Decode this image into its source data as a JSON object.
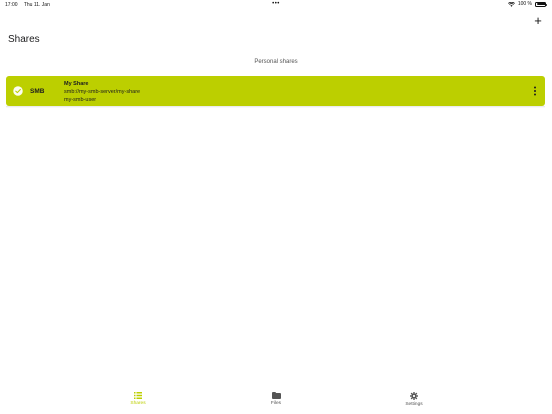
{
  "status_bar": {
    "time": "17:00",
    "date": "Thu 11. Jan",
    "battery": "100 %",
    "battery_level": 1.0
  },
  "header": {
    "title": "Shares",
    "add_icon": "plus-icon"
  },
  "section": {
    "title": "Personal shares"
  },
  "shares": [
    {
      "type": "SMB",
      "name": "My Share",
      "path": "smb://my-smb-server/my-share",
      "user": "my-smb-user",
      "status_icon": "checkmark-circle-icon",
      "menu_icon": "more-vertical-icon"
    }
  ],
  "tab_bar": {
    "tabs": [
      {
        "label": "Shares",
        "icon": "list-icon",
        "active": true
      },
      {
        "label": "Files",
        "icon": "folder-icon",
        "active": false
      },
      {
        "label": "Settings",
        "icon": "gear-icon",
        "active": false
      }
    ]
  },
  "colors": {
    "accent": "#bccf00",
    "inactive": "#555555"
  }
}
